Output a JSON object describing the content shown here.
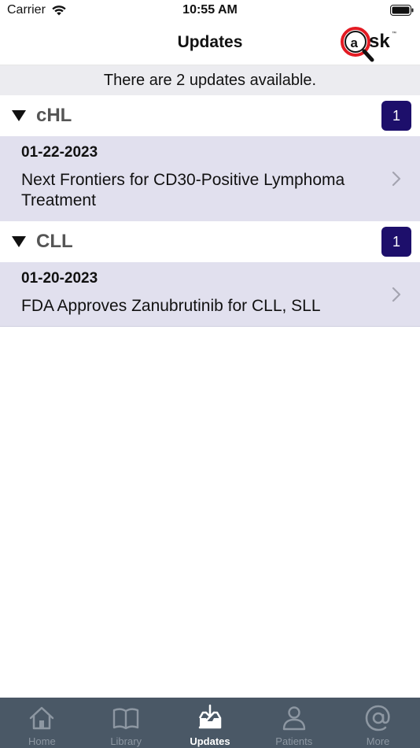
{
  "status_bar": {
    "carrier": "Carrier",
    "time": "10:55 AM"
  },
  "header": {
    "title": "Updates",
    "logo_text": "sk"
  },
  "banner": {
    "text": "There are 2 updates available."
  },
  "sections": [
    {
      "label": "cHL",
      "count": "1",
      "items": [
        {
          "date": "01-22-2023",
          "title": "Next Frontiers for CD30-Positive Lymphoma Treatment"
        }
      ]
    },
    {
      "label": "CLL",
      "count": "1",
      "items": [
        {
          "date": "01-20-2023",
          "title": "FDA Approves Zanubrutinib for CLL, SLL"
        }
      ]
    }
  ],
  "tabs": [
    {
      "label": "Home",
      "icon": "home-icon",
      "active": false
    },
    {
      "label": "Library",
      "icon": "book-icon",
      "active": false
    },
    {
      "label": "Updates",
      "icon": "inbox-download-icon",
      "active": true
    },
    {
      "label": "Patients",
      "icon": "person-icon",
      "active": false
    },
    {
      "label": "More",
      "icon": "at-icon",
      "active": false
    }
  ],
  "colors": {
    "badge": "#1d0f6b",
    "item_background": "#e1e0ee",
    "banner_background": "#ececf0",
    "tab_bar": "#4a5866",
    "logo_red": "#e31b23"
  }
}
